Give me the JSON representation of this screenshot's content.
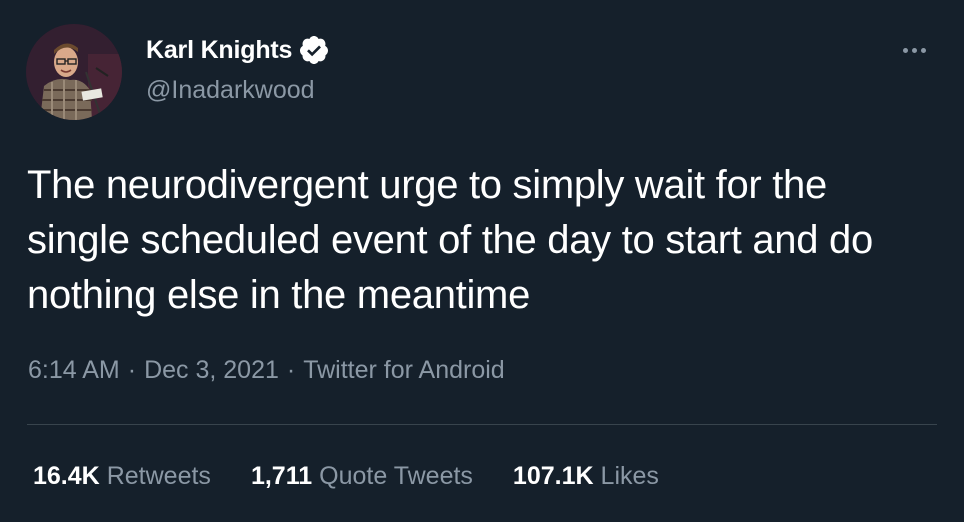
{
  "author": {
    "display_name": "Karl Knights",
    "handle": "@Inadarkwood",
    "verified": true
  },
  "tweet": {
    "text": "The neurodivergent urge to simply wait for the single scheduled event of the day to start and do nothing else in the meantime",
    "time": "6:14 AM",
    "separator": "·",
    "date": "Dec 3, 2021",
    "source": "Twitter for Android"
  },
  "stats": {
    "retweets_count": "16.4K",
    "retweets_label": "Retweets",
    "quotes_count": "1,711",
    "quotes_label": "Quote Tweets",
    "likes_count": "107.1K",
    "likes_label": "Likes"
  },
  "colors": {
    "background": "#15202b",
    "primary_text": "#ffffff",
    "secondary_text": "#8b98a5",
    "divider": "#38444d",
    "verified_badge": "#ffffff"
  },
  "icons": {
    "verified": "verified-badge-icon",
    "more": "more-options-icon"
  }
}
